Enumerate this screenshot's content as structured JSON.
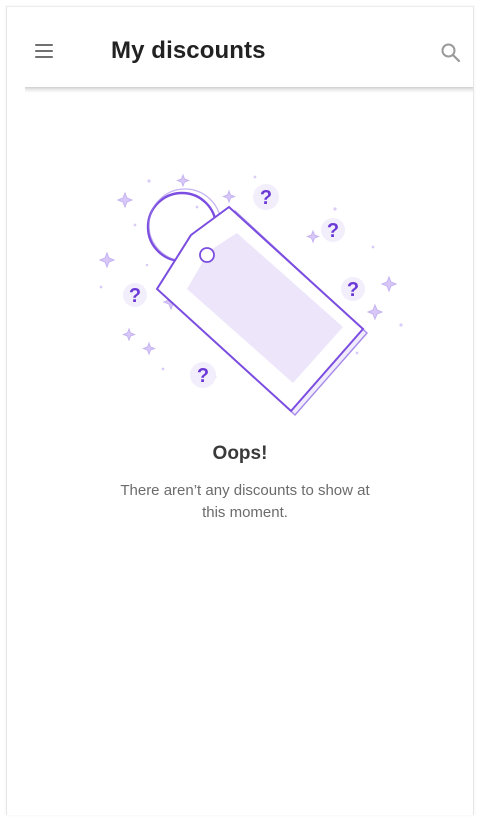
{
  "header": {
    "title": "My discounts",
    "menu_icon": "menu-icon",
    "search_icon": "search-icon"
  },
  "empty_state": {
    "title": "Oops!",
    "message": "There aren’t any discounts to show at this moment.",
    "illustration_icon": "discount-tag-icon",
    "question_mark": "?"
  },
  "colors": {
    "accent": "#7b4de0",
    "accent_light": "#efe9fb",
    "header_text": "#222222",
    "icon_gray": "#707070"
  }
}
